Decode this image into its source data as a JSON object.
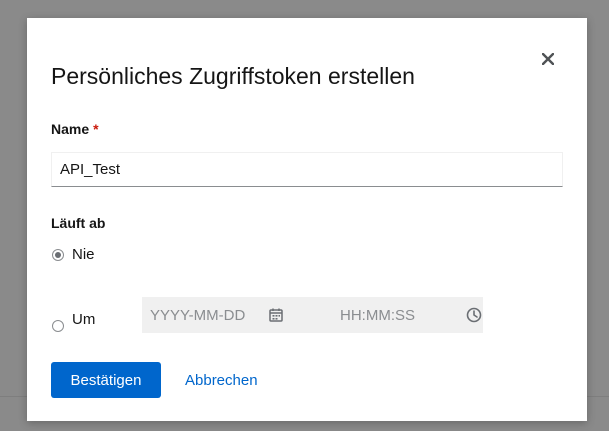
{
  "dialog": {
    "title": "Persönliches Zugriffstoken erstellen",
    "close_icon": "close-icon"
  },
  "name_field": {
    "label": "Name",
    "required_marker": "*",
    "value": "API_Test"
  },
  "expiry": {
    "label": "Läuft ab",
    "option_never": "Nie",
    "option_at": "Um",
    "selected": "never",
    "date_placeholder": "YYYY-MM-DD",
    "time_placeholder": "HH:MM:SS",
    "date_icon": "calendar-icon",
    "time_icon": "clock-icon"
  },
  "actions": {
    "confirm_label": "Bestätigen",
    "cancel_label": "Abbrechen"
  },
  "colors": {
    "primary": "#0066cc",
    "required": "#c9190b",
    "backdrop": "#8a8a8a"
  }
}
